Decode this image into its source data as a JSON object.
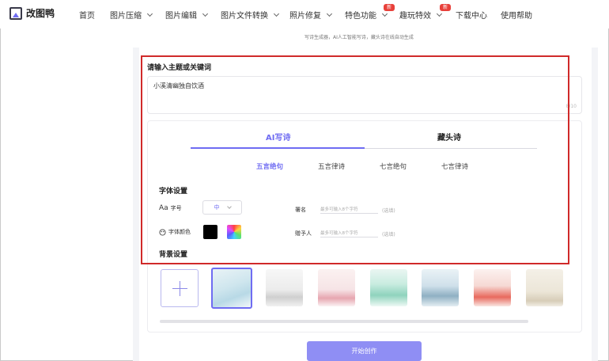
{
  "brand": {
    "name": "改图鸭"
  },
  "nav": {
    "home": "首页",
    "compress": "图片压缩",
    "edit": "图片编辑",
    "convert": "图片文件转换",
    "repair": "照片修复",
    "features": "特色功能",
    "fun": "趣玩特效",
    "download": "下载中心",
    "help": "使用帮助",
    "hot_badge": "新"
  },
  "subtitle": "写诗生成器，AI人工智能写诗，藏头诗在线自动生成",
  "prompt": {
    "title": "请输入主题或关键词",
    "value": "小溪清幽独自饮酒",
    "counter": "8/10"
  },
  "tabs": {
    "ai": "AI写诗",
    "acrostic": "藏头诗"
  },
  "poem_types": [
    "五言绝句",
    "五言律诗",
    "七言绝句",
    "七言律诗"
  ],
  "font_settings": {
    "title": "字体设置",
    "size_label": "字号",
    "size_value": "中",
    "color_label": "字体颜色",
    "signature_label": "署名",
    "signature_placeholder": "最多可输入8个字符",
    "recipient_label": "赠予人",
    "recipient_placeholder": "最多可输入8个字符",
    "optional": "(选填)"
  },
  "background": {
    "title": "背景设置"
  },
  "start_button": "开始创作",
  "colors": {
    "accent": "#6f6cf2",
    "highlight": "#d02a2a",
    "badge": "#e8403a"
  }
}
